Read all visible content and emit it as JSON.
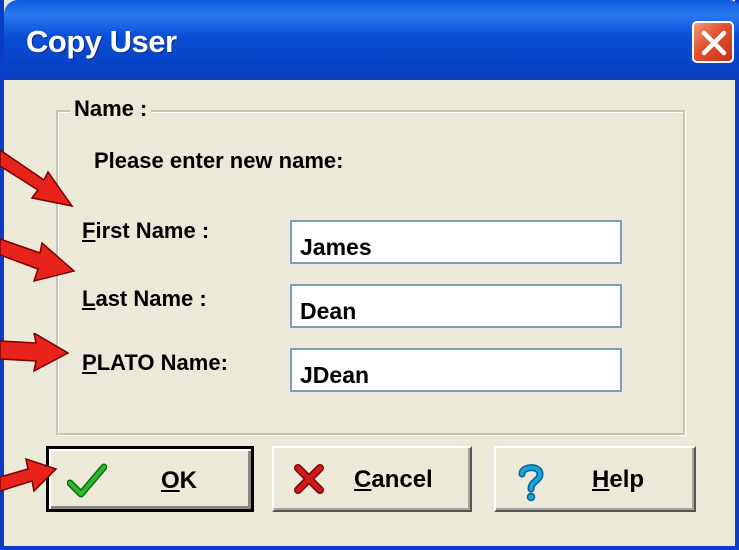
{
  "window": {
    "title": "Copy User"
  },
  "group": {
    "legend": "Name :",
    "prompt": "Please enter new name:"
  },
  "fields": [
    {
      "label_access": "F",
      "label_rest": "irst Name :",
      "value": "James"
    },
    {
      "label_access": "L",
      "label_rest": "ast Name :",
      "value": "Dean"
    },
    {
      "label_access": "P",
      "label_rest": "LATO Name:",
      "value": "JDean"
    }
  ],
  "buttons": {
    "ok": {
      "access": "O",
      "rest": "K"
    },
    "cancel": {
      "access": "C",
      "rest": "ancel"
    },
    "help": {
      "access": "H",
      "rest": "elp"
    }
  },
  "colors": {
    "titlebar": "#0743c7",
    "close": "#e0502d",
    "arrow": "#e8231b",
    "ok_check": "#1e9a1e",
    "cancel_x": "#d01a1a",
    "help_q": "#1aa3e0"
  },
  "icons": {
    "close": "close-icon",
    "ok": "checkmark-icon",
    "cancel": "x-icon",
    "help": "question-icon",
    "annotation": "red-arrow-icon"
  }
}
